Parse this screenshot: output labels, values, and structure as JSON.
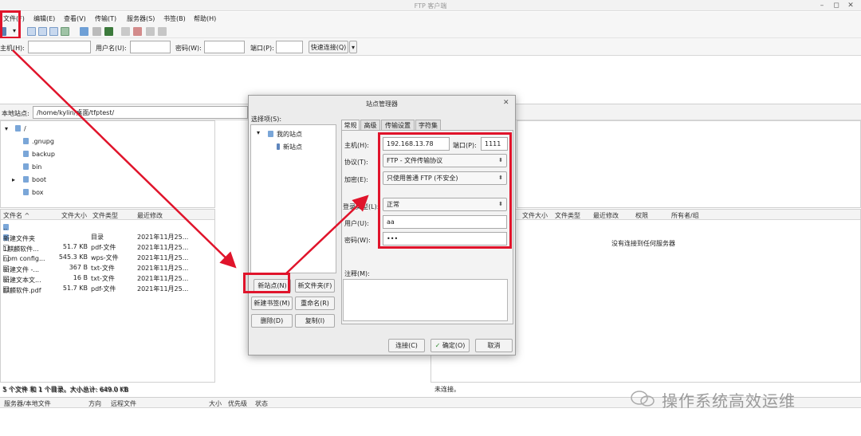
{
  "window": {
    "title": "FTP 客户端",
    "minimize": "–",
    "maximize": "◻",
    "close": "✕"
  },
  "menu": [
    "文件(F)",
    "编辑(E)",
    "查看(V)",
    "传输(T)",
    "服务器(S)",
    "书签(B)",
    "帮助(H)"
  ],
  "quickconnect": {
    "host_label": "主机(H):",
    "user_label": "用户名(U):",
    "pass_label": "密码(W):",
    "port_label": "端口(P):",
    "connect_button": "快速连接(Q)",
    "dropdown": "▾"
  },
  "local": {
    "path_label": "本地站点:",
    "path_value": "/home/kylin/桌面/tfptest/",
    "tree": [
      {
        "label": "/",
        "expander": "▾"
      },
      {
        "label": ".gnupg"
      },
      {
        "label": "backup"
      },
      {
        "label": "bin"
      },
      {
        "label": "boot",
        "expander": "▸"
      },
      {
        "label": "box"
      }
    ],
    "columns": [
      "文件名 ^",
      "文件大小",
      "文件类型",
      "最近修改"
    ],
    "files": [
      {
        "name": "..",
        "size": "",
        "type": "",
        "modified": ""
      },
      {
        "name": "新建文件夹",
        "size": "",
        "type": "目录",
        "modified": "2021年11月25..."
      },
      {
        "name": "1麒麟软件...",
        "size": "51.7 KB",
        "type": "pdf-文件",
        "modified": "2021年11月25..."
      },
      {
        "name": "npm config...",
        "size": "545.3 KB",
        "type": "wps-文件",
        "modified": "2021年11月25..."
      },
      {
        "name": "新建文件 -...",
        "size": "367 B",
        "type": "txt-文件",
        "modified": "2021年11月25..."
      },
      {
        "name": "新建文本文...",
        "size": "16 B",
        "type": "txt-文件",
        "modified": "2021年11月25..."
      },
      {
        "name": "麒麟软件.pdf",
        "size": "51.7 KB",
        "type": "pdf-文件",
        "modified": "2021年11月25..."
      }
    ],
    "status": "5 个文件 和 1 个目录。大小总计: 649.0 KB"
  },
  "remote": {
    "columns": [
      "文件大小",
      "文件类型",
      "最近修改",
      "权限",
      "所有者/组"
    ],
    "empty_message": "没有连接到任何服务器",
    "status": "未连接。"
  },
  "queue": {
    "columns": [
      "服务器/本地文件",
      "方向",
      "远程文件",
      "大小",
      "优先级",
      "状态"
    ]
  },
  "dialog": {
    "title": "站点管理器",
    "close": "✕",
    "select_label": "选择项(S):",
    "tree_root": "我的站点",
    "tree_child": "新站点",
    "tree_expander": "▾",
    "tabs": [
      "常规",
      "高级",
      "传输设置",
      "字符集"
    ],
    "host_label": "主机(H):",
    "host_value": "192.168.13.78",
    "port_label": "端口(P):",
    "port_value": "1111",
    "protocol_label": "协议(T):",
    "protocol_value": "FTP - 文件传输协议",
    "encrypt_label": "加密(E):",
    "encrypt_value": "只使用普通 FTP (不安全)",
    "logon_label": "登录类型(L):",
    "logon_value": "正常",
    "user_label": "用户(U):",
    "user_value": "aa",
    "pass_label": "密码(W):",
    "pass_value": "•••",
    "comment_label": "注释(M):",
    "buttons": {
      "new_site": "新站点(N)",
      "new_folder": "新文件夹(F)",
      "new_bookmark": "新建书签(M)",
      "rename": "重命名(R)",
      "delete": "删除(D)",
      "copy": "复制(I)",
      "connect": "连接(C)",
      "ok": "确定(O)",
      "cancel": "取消"
    }
  },
  "watermark": {
    "text": "操作系统高效运维"
  },
  "colors": {
    "highlight": "#e0142b",
    "folder": "#7aa6d8"
  }
}
